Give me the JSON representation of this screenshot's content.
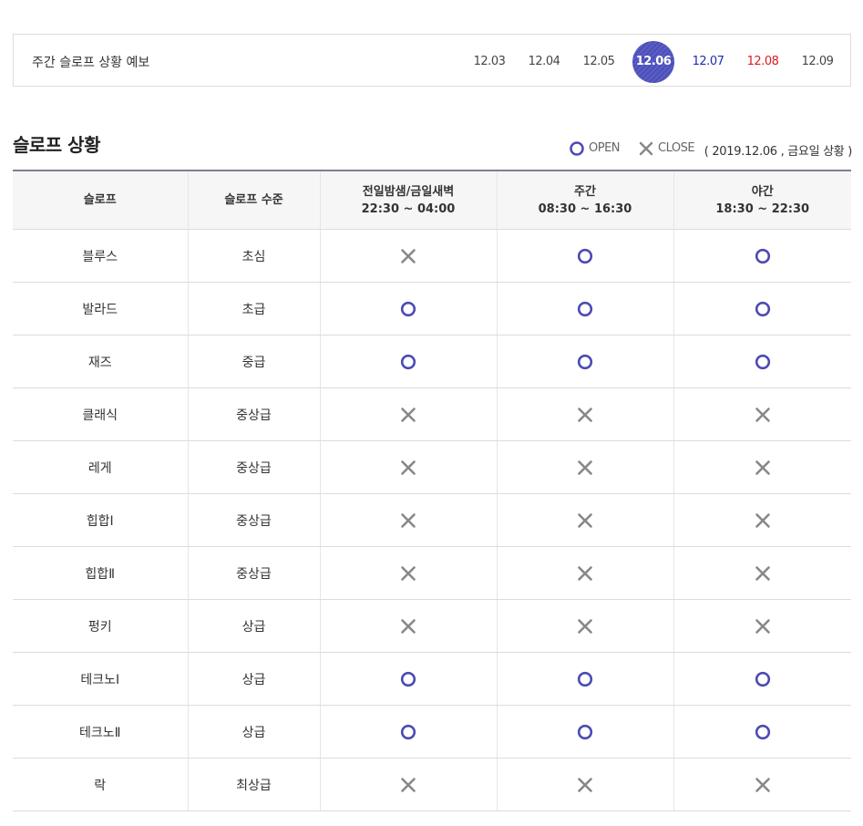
{
  "forecast": {
    "title": "주간 슬로프 상황 예보",
    "dates": [
      {
        "label": "12.03",
        "type": "weekday",
        "active": false
      },
      {
        "label": "12.04",
        "type": "weekday",
        "active": false
      },
      {
        "label": "12.05",
        "type": "weekday",
        "active": false
      },
      {
        "label": "12.06",
        "type": "weekday",
        "active": true
      },
      {
        "label": "12.07",
        "type": "sat",
        "active": false
      },
      {
        "label": "12.08",
        "type": "sun",
        "active": false
      },
      {
        "label": "12.09",
        "type": "weekday",
        "active": false
      }
    ]
  },
  "section": {
    "title": "슬로프 상황",
    "legend_open": "OPEN",
    "legend_close": "CLOSE",
    "status_date": "( 2019.12.06 , 금요일 상황 )"
  },
  "colors": {
    "open": "#4a4bb4",
    "close": "#888888",
    "active_date": "#4b4fb8",
    "saturday": "#1f2cb0",
    "sunday": "#e01a1a"
  },
  "table": {
    "headers": [
      {
        "line1": "슬로프",
        "line2": ""
      },
      {
        "line1": "슬로프 수준",
        "line2": ""
      },
      {
        "line1": "전일밤샘/금일새벽",
        "line2": "22:30 ~ 04:00"
      },
      {
        "line1": "주간",
        "line2": "08:30 ~ 16:30"
      },
      {
        "line1": "야간",
        "line2": "18:30 ~ 22:30"
      }
    ],
    "rows": [
      {
        "slope": "블루스",
        "level": "초심",
        "night": "close",
        "day": "open",
        "evening": "open"
      },
      {
        "slope": "발라드",
        "level": "초급",
        "night": "open",
        "day": "open",
        "evening": "open"
      },
      {
        "slope": "재즈",
        "level": "중급",
        "night": "open",
        "day": "open",
        "evening": "open"
      },
      {
        "slope": "클래식",
        "level": "중상급",
        "night": "close",
        "day": "close",
        "evening": "close"
      },
      {
        "slope": "레게",
        "level": "중상급",
        "night": "close",
        "day": "close",
        "evening": "close"
      },
      {
        "slope": "힙합Ⅰ",
        "level": "중상급",
        "night": "close",
        "day": "close",
        "evening": "close"
      },
      {
        "slope": "힙합Ⅱ",
        "level": "중상급",
        "night": "close",
        "day": "close",
        "evening": "close"
      },
      {
        "slope": "펑키",
        "level": "상급",
        "night": "close",
        "day": "close",
        "evening": "close"
      },
      {
        "slope": "테크노Ⅰ",
        "level": "상급",
        "night": "open",
        "day": "open",
        "evening": "open"
      },
      {
        "slope": "테크노Ⅱ",
        "level": "상급",
        "night": "open",
        "day": "open",
        "evening": "open"
      },
      {
        "slope": "락",
        "level": "최상급",
        "night": "close",
        "day": "close",
        "evening": "close"
      }
    ]
  }
}
